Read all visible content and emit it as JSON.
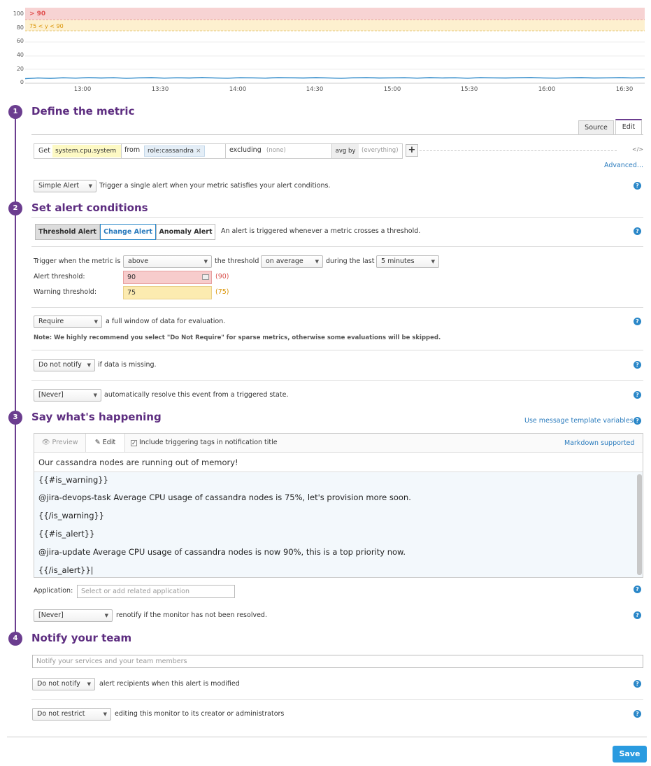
{
  "chart": {
    "y_ticks": [
      "100",
      "80",
      "60",
      "40",
      "20",
      "0"
    ],
    "x_ticks": [
      "13:00",
      "13:30",
      "14:00",
      "14:30",
      "15:00",
      "15:30",
      "16:00",
      "16:30"
    ],
    "alert_band_label": "> 90",
    "warning_band_label": "75 < y < 90",
    "alert_color": "#f7d3d3",
    "warning_color": "#fdf0cf",
    "series_color": "#2a87c8"
  },
  "chart_data": {
    "type": "line",
    "ylim": [
      0,
      100
    ],
    "x_ticks": [
      "13:00",
      "13:30",
      "14:00",
      "14:30",
      "15:00",
      "15:30",
      "16:00",
      "16:30"
    ],
    "alert_threshold": 90,
    "warning_threshold": 75,
    "series": [
      {
        "values": [
          6,
          7,
          6.5,
          7.2,
          6.8,
          7.5,
          6.9,
          7.3,
          6.6,
          7.1,
          7.4,
          6.8,
          7.2,
          6.9,
          7.6,
          7,
          6.7,
          7.3,
          7.1,
          6.8,
          7.5,
          7.2,
          6.9,
          7.4,
          7,
          6.6,
          7.2,
          7.5,
          6.9,
          7.1,
          7.3,
          6.8,
          7.4,
          7,
          7.2,
          6.7,
          7.5,
          7.1,
          6.9,
          7.3,
          7.6,
          7,
          6.8,
          7.2,
          7.4,
          6.9,
          7.1,
          7.5,
          7,
          7.3
        ]
      }
    ]
  },
  "step1": {
    "num": "1",
    "title": "Define the metric",
    "tab_source": "Source",
    "tab_edit": "Edit",
    "get_label": "Get",
    "metric": "system.cpu.system",
    "from_label": "from",
    "from_tag": "role:cassandra",
    "excluding_label": "excluding",
    "excluding_value": "(none)",
    "avgby_label": "avg by",
    "avgby_value": "(everything)",
    "plus": "+",
    "code_icon": "</>",
    "advanced": "Advanced...",
    "alert_type": "Simple Alert",
    "alert_type_desc": "Trigger a single alert when your metric satisfies your alert conditions."
  },
  "step2": {
    "num": "2",
    "title": "Set alert conditions",
    "tabs": [
      "Threshold Alert",
      "Change Alert",
      "Anomaly Alert"
    ],
    "tabs_desc": "An alert is triggered whenever a metric crosses a threshold.",
    "trigger_label": "Trigger when the metric is",
    "trigger_value": "above",
    "threshold_label": "the threshold",
    "agg_value": "on average",
    "during_label": "during the last",
    "window_value": "5 minutes",
    "alert_threshold_label": "Alert threshold:",
    "alert_threshold_value": "90",
    "alert_threshold_echo": "(90)",
    "warning_threshold_label": "Warning threshold:",
    "warning_threshold_value": "75",
    "warning_threshold_echo": "(75)",
    "require_value": "Require",
    "require_desc": "a full window of data for evaluation.",
    "require_note": "Note: We highly recommend you select \"Do Not Require\" for sparse metrics, otherwise some evaluations will be skipped.",
    "missing_value": "Do not notify",
    "missing_desc": "if data is missing.",
    "resolve_value": "[Never]",
    "resolve_desc": "automatically resolve this event from a triggered state."
  },
  "step3": {
    "num": "3",
    "title": "Say what's happening",
    "template_link": "Use message template variables",
    "preview": "Preview",
    "edit": "Edit",
    "include_tags": "Include triggering tags in notification title",
    "markdown": "Markdown supported",
    "subject": "Our cassandra nodes are running out of memory!",
    "body_lines": [
      "{{#is_warning}}",
      "@jira-devops-task Average CPU usage of cassandra nodes is 75%, let's provision more soon.",
      "{{/is_warning}}",
      "{{#is_alert}}",
      "@jira-update Average CPU usage of cassandra nodes is now 90%, this is a top priority now.",
      "{{/is_alert}}|"
    ],
    "application_label": "Application:",
    "application_placeholder": "Select or add related application",
    "renotify_value": "[Never]",
    "renotify_desc": "renotify if the monitor has not been resolved."
  },
  "step4": {
    "num": "4",
    "title": "Notify your team",
    "notify_placeholder": "Notify your services and your team members",
    "modified_value": "Do not notify",
    "modified_desc": "alert recipients when this alert is modified",
    "restrict_value": "Do not restrict",
    "restrict_desc": "editing this monitor to its creator or administrators"
  },
  "save": "Save",
  "help_glyph": "?",
  "caret": "▼"
}
